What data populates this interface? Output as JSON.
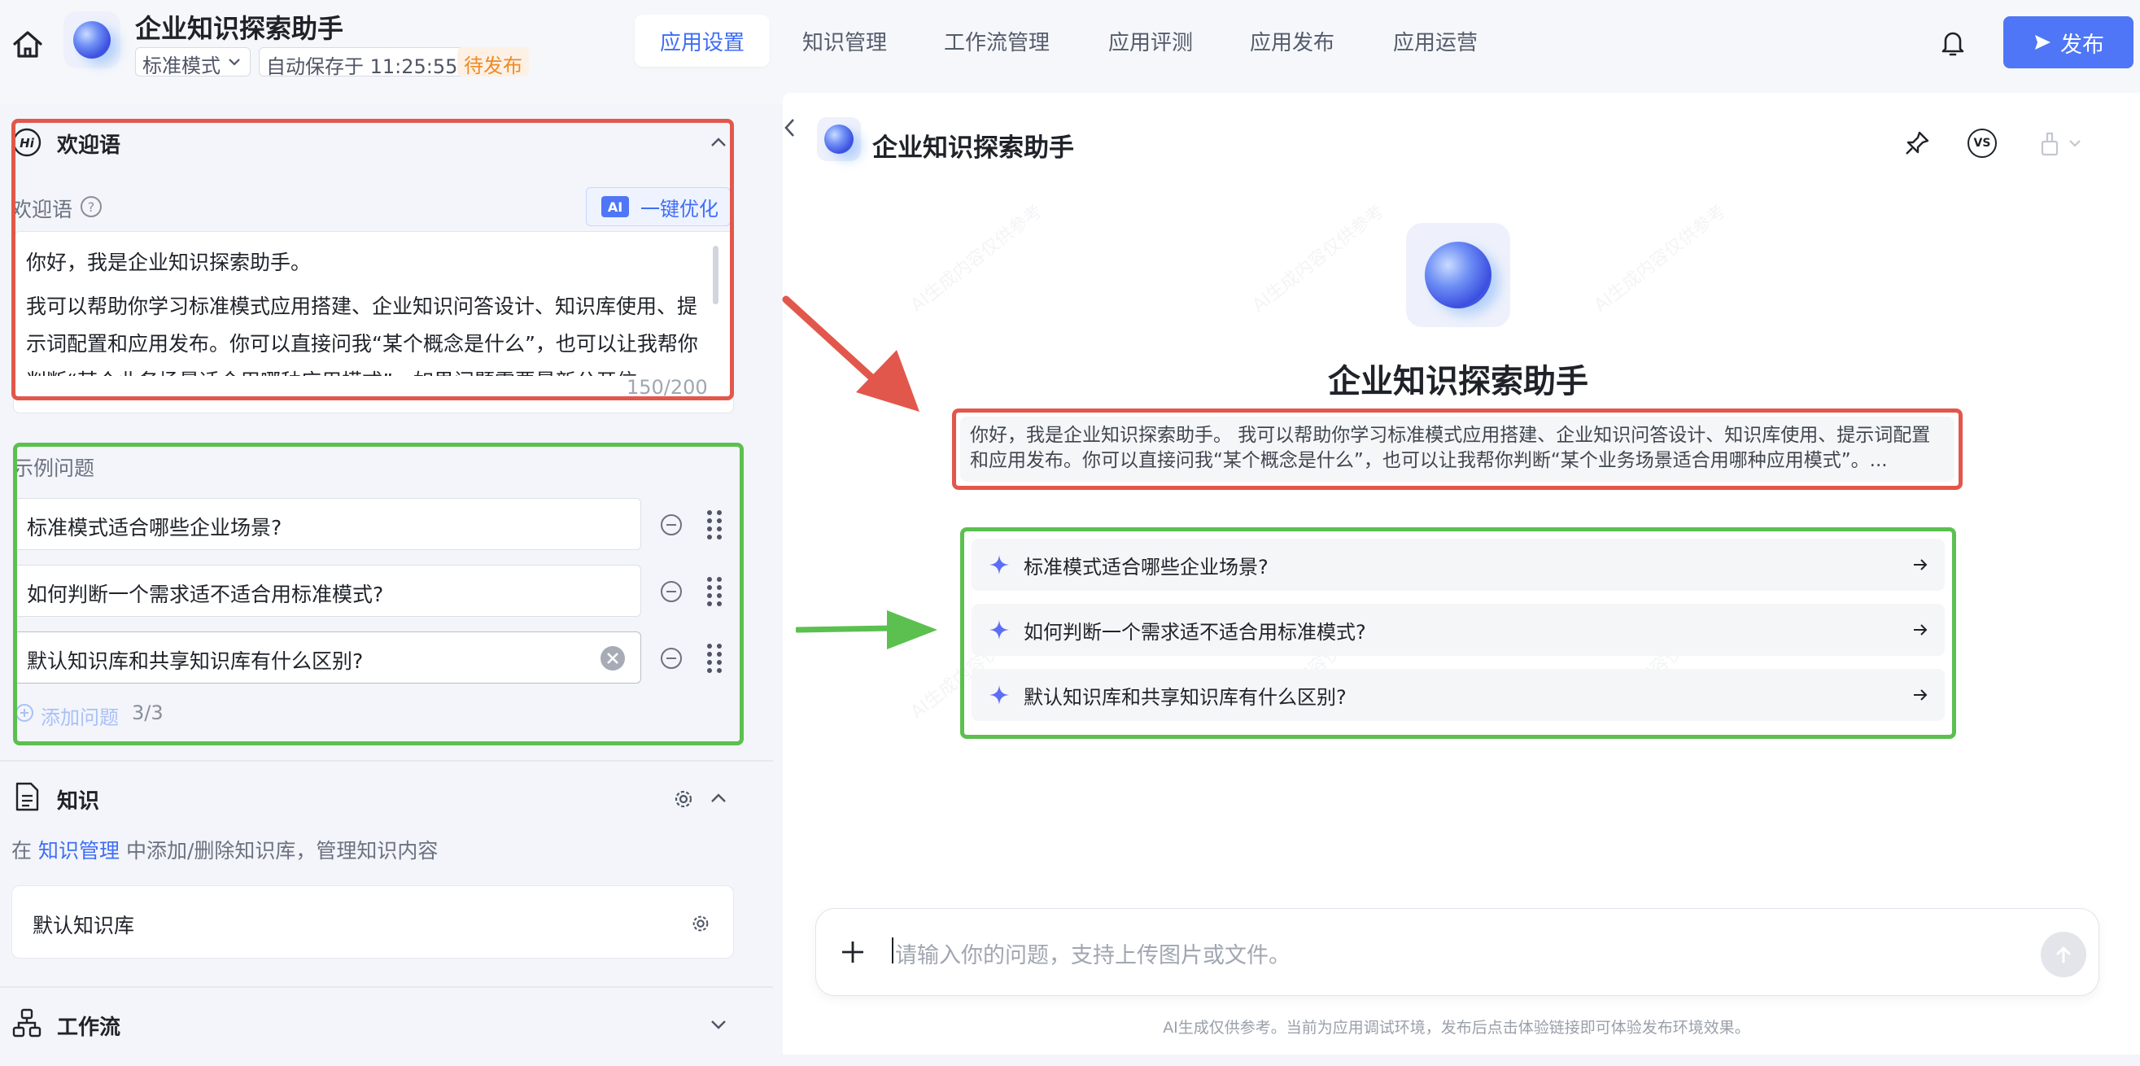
{
  "header": {
    "app_name": "企业知识探索助手",
    "mode": "标准模式",
    "autosave": "自动保存于 11:25:55",
    "status": "待发布",
    "tabs": [
      {
        "label": "应用设置",
        "active": true
      },
      {
        "label": "知识管理",
        "active": false
      },
      {
        "label": "工作流管理",
        "active": false
      },
      {
        "label": "应用评测",
        "active": false
      },
      {
        "label": "应用发布",
        "active": false
      },
      {
        "label": "应用运营",
        "active": false
      }
    ],
    "publish_label": "发布",
    "icons": {
      "home": "home-icon",
      "bell": "bell-icon",
      "send": "send-icon"
    }
  },
  "welcome": {
    "section_title": "欢迎语",
    "field_label": "欢迎语",
    "ai_chip": "AI",
    "optimize_label": "一键优化",
    "text_line1": "你好，我是企业知识探索助手。",
    "text_line2": "我可以帮助你学习标准模式应用搭建、企业知识问答设计、知识库使用、提示词配置和应用发布。你可以直接问我“某个概念是什么”，也可以让我帮你判断“某个业务场景适合用哪种应用模式”。如果问题需要最新公开信",
    "counter": "150/200"
  },
  "examples": {
    "label": "示例问题",
    "questions": [
      "标准模式适合哪些企业场景?",
      "如何判断一个需求适不适合用标准模式?",
      "默认知识库和共享知识库有什么区别?"
    ],
    "add_label": "添加问题",
    "count": "3/3"
  },
  "knowledge": {
    "section_title": "知识",
    "hint_prefix": "在",
    "hint_link": "知识管理",
    "hint_suffix": "中添加/删除知识库，管理知识内容",
    "kb_name": "默认知识库"
  },
  "workflow": {
    "section_title": "工作流"
  },
  "chat": {
    "title": "企业知识探索助手",
    "vs_label": "VS",
    "welcome_preview": "你好，我是企业知识探索助手。 我可以帮助你学习标准模式应用搭建、企业知识问答设计、知识库使用、提示词配置和应用发布。你可以直接问我“某个概念是什么”，也可以让我帮你判断“某个业务场景适合用哪种应用模式”。...",
    "suggestions": [
      "标准模式适合哪些企业场景?",
      "如何判断一个需求适不适合用标准模式?",
      "默认知识库和共享知识库有什么区别?"
    ],
    "input_placeholder": "请输入你的问题，支持上传图片或文件。",
    "disclaimer": "AI生成仅供参考。当前为应用调试环境，发布后点击体验链接即可体验发布环境效果。",
    "watermark": "AI生成内容仅供参考"
  },
  "colors": {
    "accent": "#3f6df6",
    "publish_bg": "#4e76f6",
    "pending": "#f08a24",
    "annotation_red": "#e2574c",
    "annotation_green": "#5bc04f"
  }
}
